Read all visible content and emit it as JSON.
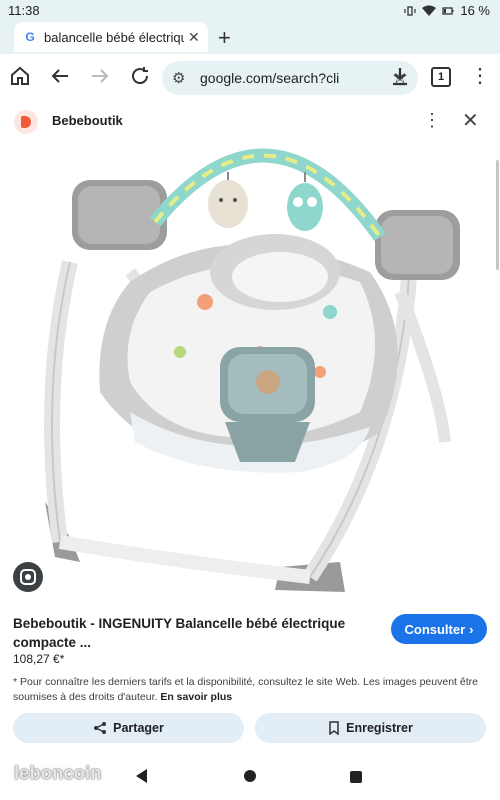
{
  "status": {
    "time": "11:38",
    "battery": "16 %"
  },
  "tab": {
    "title": "balancelle bébé électrique - F",
    "g_letter": "G"
  },
  "toolbar": {
    "url": "google.com/search?cli",
    "tab_count": "1"
  },
  "sheet": {
    "site_name": "Bebeboutik"
  },
  "product": {
    "title": "Bebeboutik - INGENUITY Balancelle bébé électrique compacte ...",
    "price": "108,27 €*",
    "consult_label": "Consulter",
    "disclaimer": "* Pour connaître les derniers tarifs et la disponibilité, consultez le site Web. Les images peuvent être soumises à des droits d'auteur.",
    "learn_more": "En savoir plus",
    "share_label": "Partager",
    "save_label": "Enregistrer"
  },
  "watermark": "leboncoin"
}
